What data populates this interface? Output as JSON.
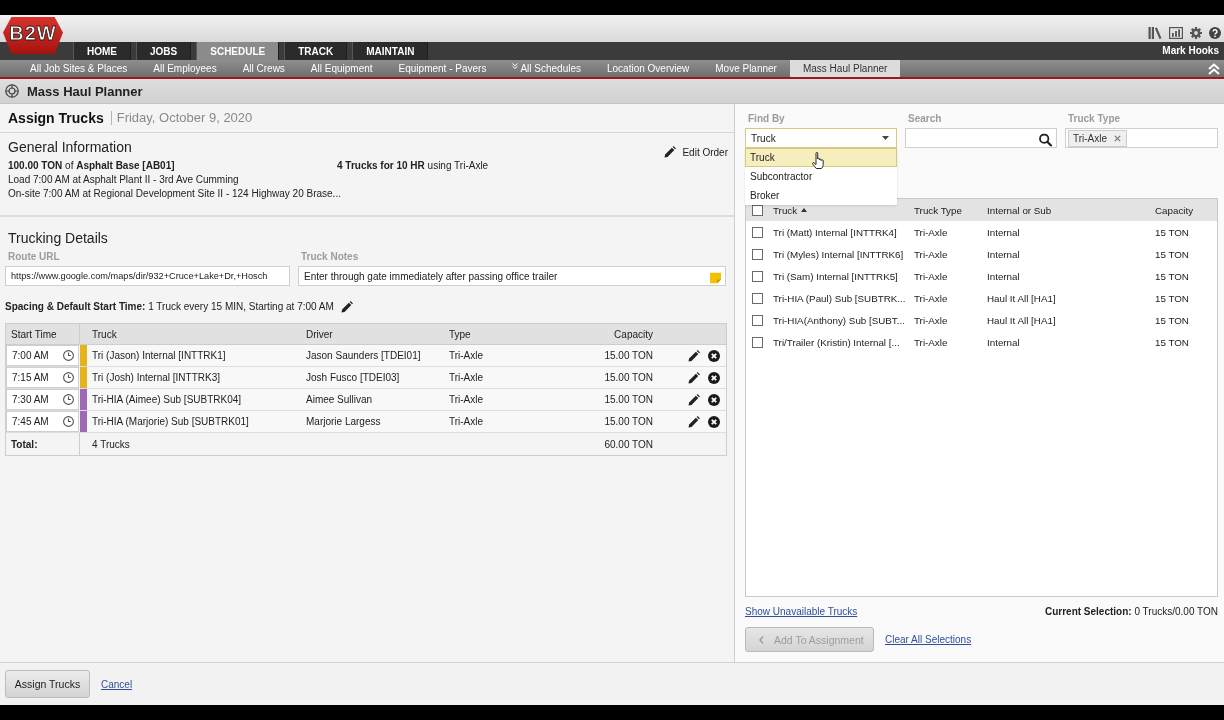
{
  "header": {
    "logo": "B2W",
    "user_name": "Mark Hooks"
  },
  "nav_tabs": [
    {
      "label": "HOME",
      "selected": false
    },
    {
      "label": "JOBS",
      "selected": false
    },
    {
      "label": "SCHEDULE",
      "selected": true
    },
    {
      "label": "TRACK",
      "selected": false
    },
    {
      "label": "MAINTAIN",
      "selected": false
    }
  ],
  "subnav": [
    {
      "label": "All Job Sites & Places",
      "kind": "link",
      "selected": false
    },
    {
      "label": "All Employees",
      "kind": "link",
      "selected": false
    },
    {
      "label": "All Crews",
      "kind": "link",
      "selected": false
    },
    {
      "label": "All Equipment",
      "kind": "link",
      "selected": false
    },
    {
      "label": "Equipment - Pavers",
      "kind": "link",
      "selected": false
    },
    {
      "label": "All Schedules",
      "kind": "menu",
      "selected": false
    },
    {
      "label": "Location Overview",
      "kind": "link",
      "selected": false
    },
    {
      "label": "Move Planner",
      "kind": "link",
      "selected": false
    },
    {
      "label": "Mass Haul Planner",
      "kind": "link",
      "selected": true
    }
  ],
  "page_title": "Mass Haul Planner",
  "assign_header": {
    "title": "Assign Trucks",
    "date": "Friday, October 9, 2020"
  },
  "general_information": {
    "heading": "General Information",
    "edit_button": "Edit Order",
    "details": [
      "**100.00 TON** of **Asphalt Base [AB01]**",
      "Load 7:00 AM at Asphalt Plant II - 3rd Ave Cumming",
      "On-site 7:00 AM at Regional Development Site II - 124 Highway 20 Brase..."
    ],
    "summary": "**4 Trucks for 10 HR** using Tri-Axle"
  },
  "trucking_details": {
    "heading": "Trucking Details",
    "route_url": {
      "label": "Route URL",
      "value": "https://www.google.com/maps/dir/932+Cruce+Lake+Dr,+Hosch"
    },
    "truck_notes": {
      "label": "Truck Notes",
      "value": "Enter through gate immediately after passing office trailer"
    },
    "spacing": "**Spacing & Default Start Time:** 1 Truck every 15 MIN, Starting at 7:00 AM"
  },
  "assigned_trucks": {
    "columns": [
      "Start Time",
      "Truck",
      "Driver",
      "Type",
      "Capacity"
    ],
    "rows": [
      {
        "start_time": "7:00 AM",
        "color": "#e5b31b",
        "truck": "Tri (Jason) Internal [INTTRK1]",
        "driver": "Jason Saunders [TDEI01]",
        "type": "Tri-Axle",
        "capacity": "15.00 TON"
      },
      {
        "start_time": "7:15 AM",
        "color": "#e5b31b",
        "truck": "Tri (Josh) Internal [INTTRK3]",
        "driver": "Josh Fusco [TDEI03]",
        "type": "Tri-Axle",
        "capacity": "15.00 TON"
      },
      {
        "start_time": "7:30 AM",
        "color": "#9c6ab4",
        "truck": "Tri-HIA (Aimee) Sub [SUBTRK04]",
        "driver": "Aimee Sullivan",
        "type": "Tri-Axle",
        "capacity": "15.00 TON"
      },
      {
        "start_time": "7:45 AM",
        "color": "#9c6ab4",
        "truck": "Tri-HIA (Marjorie) Sub [SUBTRK01]",
        "driver": "Marjorie Largess",
        "type": "Tri-Axle",
        "capacity": "15.00 TON"
      }
    ],
    "total": {
      "label": "Total:",
      "trucks": "4 Trucks",
      "capacity": "60.00 TON"
    }
  },
  "finder": {
    "find_by": {
      "label": "Find By",
      "value": "Truck",
      "expanded": true,
      "options": [
        {
          "label": "Truck",
          "selected": true
        },
        {
          "label": "Subcontractor",
          "selected": false
        },
        {
          "label": "Broker",
          "selected": false
        }
      ]
    },
    "search": {
      "label": "Search"
    },
    "truck_type": {
      "label": "Truck Type",
      "chips": [
        "Tri-Axle"
      ]
    },
    "table": {
      "all_checked": false,
      "columns": [
        {
          "label": "Truck",
          "sorted": true
        },
        {
          "label": "Truck Type",
          "sorted": false
        },
        {
          "label": "Internal or Sub",
          "sorted": false
        },
        {
          "label": "Capacity",
          "sorted": false
        }
      ],
      "rows": [
        {
          "truck": "Tri (Matt) Internal [INTTRK4]",
          "truck_type": "Tri-Axle",
          "internal_or_sub": "Internal",
          "capacity": "15 TON",
          "checked": false
        },
        {
          "truck": "Tri (Myles) Internal [INTTRK6]",
          "truck_type": "Tri-Axle",
          "internal_or_sub": "Internal",
          "capacity": "15 TON",
          "checked": false
        },
        {
          "truck": "Tri (Sam) Internal [INTTRK5]",
          "truck_type": "Tri-Axle",
          "internal_or_sub": "Internal",
          "capacity": "15 TON",
          "checked": false
        },
        {
          "truck": "Tri-HIA (Paul) Sub [SUBTRK...",
          "truck_type": "Tri-Axle",
          "internal_or_sub": "Haul It All [HA1]",
          "capacity": "15 TON",
          "checked": false
        },
        {
          "truck": "Tri-HIA(Anthony) Sub [SUBT...",
          "truck_type": "Tri-Axle",
          "internal_or_sub": "Haul It All [HA1]",
          "capacity": "15 TON",
          "checked": false
        },
        {
          "truck": "Tri/Trailer (Kristin) Internal [...",
          "truck_type": "Tri-Axle",
          "internal_or_sub": "Internal",
          "capacity": "15 TON",
          "checked": false
        }
      ]
    },
    "show_unavailable_link": "Show Unavailable Trucks",
    "current_selection": "**Current Selection:** 0 Trucks/0.00 TON",
    "add_button": {
      "label": "Add To Assignment",
      "disabled": true
    },
    "clear_link": "Clear All Selections"
  },
  "footer": {
    "assign_button": "Assign Trucks",
    "cancel_link": "Cancel"
  }
}
